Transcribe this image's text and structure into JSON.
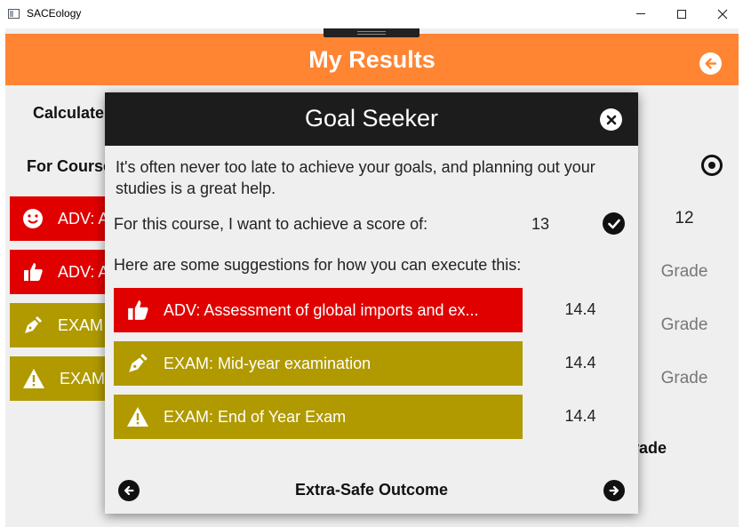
{
  "window": {
    "title": "SACEology",
    "controls": {
      "minimize": "minimize-icon",
      "maximize": "maximize-icon",
      "close": "close-icon"
    }
  },
  "header": {
    "title": "My Results",
    "back_icon": "arrow-left-circle-icon",
    "accent_color": "#ff8533"
  },
  "background": {
    "calculate_label": "Calculate",
    "for_course_label": "For Course",
    "target_icon": "target-icon",
    "cards": [
      {
        "label": "ADV: A",
        "icon": "smiley-icon",
        "color": "#e00000",
        "value": "12"
      },
      {
        "label": "ADV: A",
        "icon": "thumbs-up-icon",
        "color": "#e00000",
        "value": "Grade"
      },
      {
        "label": "EXAM",
        "icon": "pen-nib-icon",
        "color": "#b09a00",
        "value": "Grade"
      },
      {
        "label": "EXAM",
        "icon": "warning-icon",
        "color": "#b09a00",
        "value": "Grade"
      }
    ],
    "grade_label": "rade"
  },
  "modal": {
    "title": "Goal Seeker",
    "close_icon": "close-circle-icon",
    "intro": "It's often never too late to achieve your goals, and planning out your studies is a great help.",
    "score_label": "For this course, I want to achieve a score of:",
    "score_value": "13",
    "confirm_icon": "check-circle-icon",
    "suggestions_label": "Here are some suggestions for how you can execute this:",
    "suggestions": [
      {
        "label": "ADV: Assessment of global imports and ex...",
        "value": "14.4",
        "icon": "thumbs-up-icon",
        "color": "#e00000"
      },
      {
        "label": "EXAM: Mid-year examination",
        "value": "14.4",
        "icon": "pen-nib-icon",
        "color": "#b09a00"
      },
      {
        "label": "EXAM: End of Year Exam",
        "value": "14.4",
        "icon": "warning-icon",
        "color": "#b09a00"
      }
    ],
    "outcome": "Extra-Safe Outcome",
    "prev_icon": "arrow-left-circle-icon",
    "next_icon": "arrow-right-circle-icon"
  }
}
